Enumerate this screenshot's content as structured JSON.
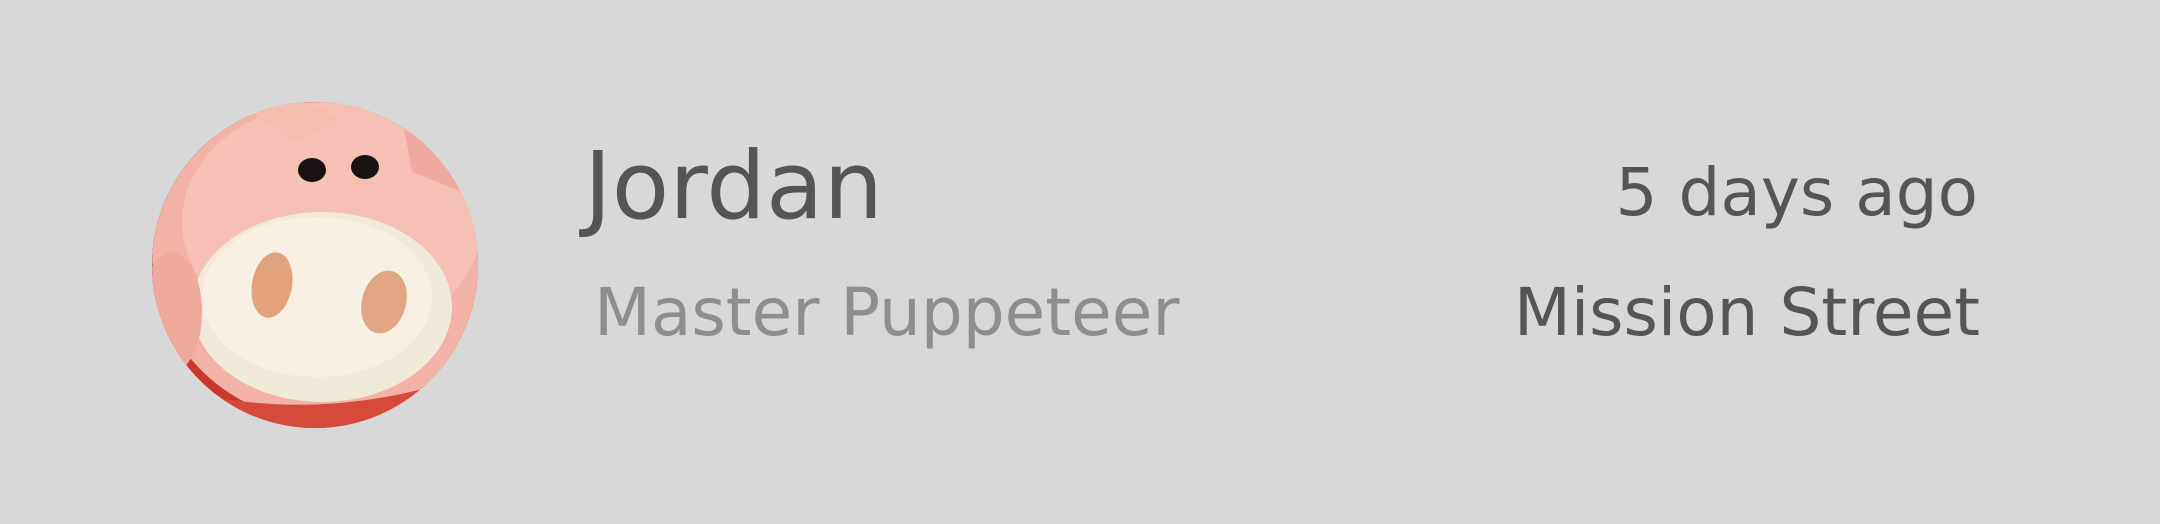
{
  "profile": {
    "name": "Jordan",
    "title": "Master Puppeteer",
    "time": "5 days ago",
    "location": "Mission Street",
    "avatar_icon": "plush-pig-photo"
  },
  "colors": {
    "background": "#d8d8d8",
    "primary_text": "#555555",
    "secondary_text": "#8e8e8e"
  }
}
